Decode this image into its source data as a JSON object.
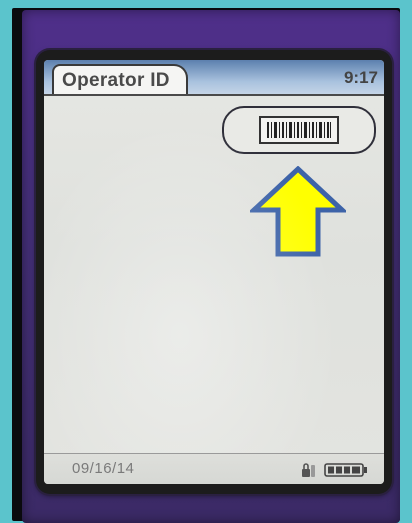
{
  "screen": {
    "title": "Operator ID",
    "time": "9:17",
    "date": "09/16/14"
  },
  "scan_button": {
    "icon": "barcode-icon"
  },
  "annotation": {
    "icon": "up-arrow-icon",
    "color": "#ffff00",
    "outline": "#3d63a8"
  },
  "status": {
    "lock_icon": "lock-icon",
    "battery_icon": "battery-icon",
    "battery_level": 1.0
  },
  "colors": {
    "device": "#45307a",
    "background": "#5bc4cc",
    "title_bar": "#a9c2de"
  }
}
